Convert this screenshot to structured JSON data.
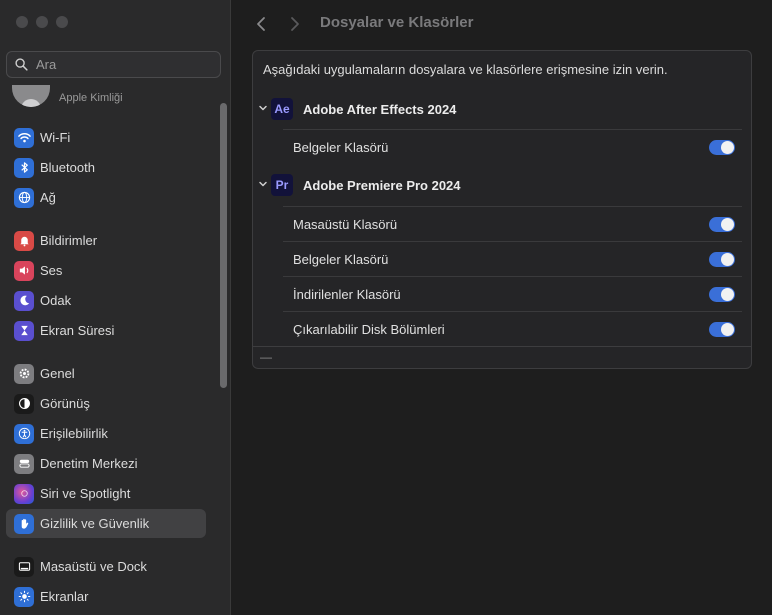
{
  "sidebar": {
    "search_placeholder": "Ara",
    "apple_id_label": "Apple Kimliği",
    "items": [
      {
        "label": "Wi-Fi",
        "icon": "wifi-icon",
        "color": "#2f6fd6"
      },
      {
        "label": "Bluetooth",
        "icon": "bluetooth-icon",
        "color": "#2f6fd6"
      },
      {
        "label": "Ağ",
        "icon": "globe-icon",
        "color": "#2f6fd6"
      },
      {
        "label": "Bildirimler",
        "icon": "bell-icon",
        "color": "#d94a46"
      },
      {
        "label": "Ses",
        "icon": "speaker-icon",
        "color": "#d9445c"
      },
      {
        "label": "Odak",
        "icon": "moon-icon",
        "color": "#5a4fcf"
      },
      {
        "label": "Ekran Süresi",
        "icon": "hourglass-icon",
        "color": "#5a4fcf"
      },
      {
        "label": "Genel",
        "icon": "gear-icon",
        "color": "#7d7d80"
      },
      {
        "label": "Görünüş",
        "icon": "appearance-icon",
        "color": "#1a1a1a"
      },
      {
        "label": "Erişilebilirlik",
        "icon": "accessibility-icon",
        "color": "#2f6fd6"
      },
      {
        "label": "Denetim Merkezi",
        "icon": "control-center-icon",
        "color": "#7d7d80"
      },
      {
        "label": "Siri ve Spotlight",
        "icon": "siri-icon",
        "color": "#8c3fd1"
      },
      {
        "label": "Gizlilik ve Güvenlik",
        "icon": "hand-icon",
        "color": "#2f6fd6"
      },
      {
        "label": "Masaüstü ve Dock",
        "icon": "dock-icon",
        "color": "#1a1a1a"
      },
      {
        "label": "Ekranlar",
        "icon": "sun-icon",
        "color": "#2f6fd6"
      }
    ]
  },
  "header": {
    "title": "Dosyalar ve Klasörler"
  },
  "panel": {
    "description": "Aşağıdaki uygulamaların dosyalara ve klasörlere erişmesine izin verin.",
    "apps": [
      {
        "name": "Adobe After Effects 2024",
        "icon_text": "Ae",
        "icon_color": "#9a9aff",
        "folders": [
          {
            "label": "Belgeler Klasörü",
            "enabled": true
          }
        ]
      },
      {
        "name": "Adobe Premiere Pro 2024",
        "icon_text": "Pr",
        "icon_color": "#9a9aff",
        "folders": [
          {
            "label": "Masaüstü Klasörü",
            "enabled": true
          },
          {
            "label": "Belgeler Klasörü",
            "enabled": true
          },
          {
            "label": "İndirilenler Klasörü",
            "enabled": true
          },
          {
            "label": "Çıkarılabilir Disk Bölümleri",
            "enabled": true
          }
        ]
      }
    ],
    "footer_minus": "—"
  },
  "colors": {
    "accent": "#3a6fd8",
    "selected_bg": "#414143"
  }
}
